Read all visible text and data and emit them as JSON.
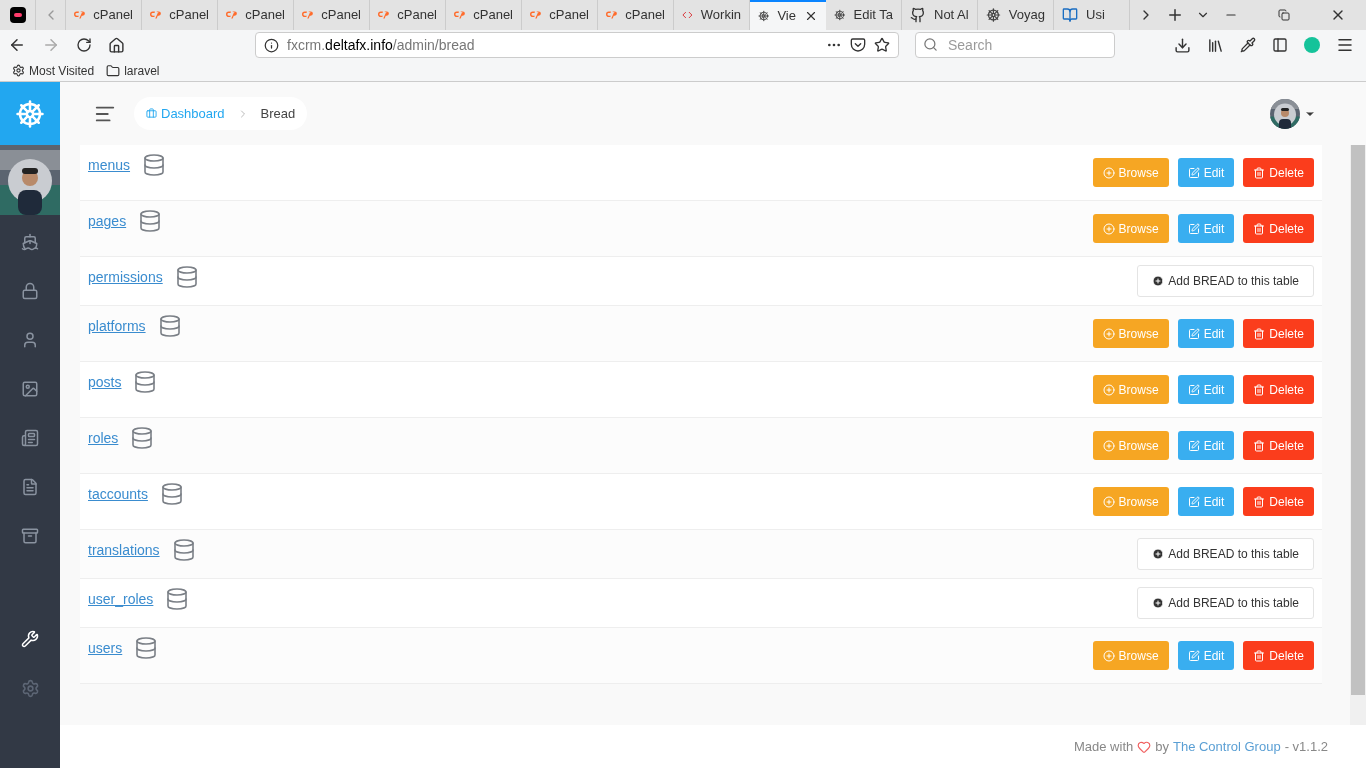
{
  "browser": {
    "tabs": [
      {
        "kind": "app",
        "selected": false
      },
      {
        "kind": "cpanel",
        "label": "cPanel",
        "selected": false
      },
      {
        "kind": "cpanel",
        "label": "cPanel",
        "selected": false
      },
      {
        "kind": "cpanel",
        "label": "cPanel",
        "selected": false
      },
      {
        "kind": "cpanel",
        "label": "cPanel",
        "selected": false
      },
      {
        "kind": "cpanel",
        "label": "cPanel",
        "selected": false
      },
      {
        "kind": "cpanel",
        "label": "cPanel",
        "selected": false
      },
      {
        "kind": "cpanel",
        "label": "cPanel",
        "selected": false
      },
      {
        "kind": "cpanel",
        "label": "cPanel",
        "selected": false
      },
      {
        "kind": "code",
        "label": "Workin",
        "selected": false
      },
      {
        "kind": "helm",
        "label": "Vie",
        "selected": true
      },
      {
        "kind": "helm",
        "label": "Edit Ta",
        "selected": false
      },
      {
        "kind": "github",
        "label": "Not Al",
        "selected": false
      },
      {
        "kind": "helm",
        "label": "Voyag",
        "selected": false
      },
      {
        "kind": "book",
        "label": "Usi",
        "selected": false
      }
    ],
    "url_host": "fxcrm.",
    "url_domain": "deltafx.info",
    "url_path": "/admin/bread",
    "search_placeholder": "Search",
    "bookmarks": [
      {
        "kind": "gear",
        "label": "Most Visited"
      },
      {
        "kind": "folder",
        "label": "laravel"
      }
    ]
  },
  "breadcrumb": [
    {
      "label": "Dashboard",
      "selected": false
    },
    {
      "label": "Bread",
      "selected": true
    }
  ],
  "tables": [
    {
      "name": "menus",
      "kind": "bread",
      "buttons": [
        "Browse",
        "Edit",
        "Delete"
      ]
    },
    {
      "name": "pages",
      "kind": "bread",
      "buttons": [
        "Browse",
        "Edit",
        "Delete"
      ]
    },
    {
      "name": "permissions",
      "kind": "add",
      "button": "Add BREAD to this table"
    },
    {
      "name": "platforms",
      "kind": "bread",
      "buttons": [
        "Browse",
        "Edit",
        "Delete"
      ]
    },
    {
      "name": "posts",
      "kind": "bread",
      "buttons": [
        "Browse",
        "Edit",
        "Delete"
      ]
    },
    {
      "name": "roles",
      "kind": "bread",
      "buttons": [
        "Browse",
        "Edit",
        "Delete"
      ]
    },
    {
      "name": "taccounts",
      "kind": "bread",
      "buttons": [
        "Browse",
        "Edit",
        "Delete"
      ]
    },
    {
      "name": "translations",
      "kind": "add",
      "button": "Add BREAD to this table"
    },
    {
      "name": "user_roles",
      "kind": "add",
      "button": "Add BREAD to this table"
    },
    {
      "name": "users",
      "kind": "bread",
      "buttons": [
        "Browse",
        "Edit",
        "Delete"
      ]
    }
  ],
  "footer": {
    "before": "Made with",
    "middle": "by",
    "link": "The Control Group",
    "after": "- v1.1.2"
  }
}
